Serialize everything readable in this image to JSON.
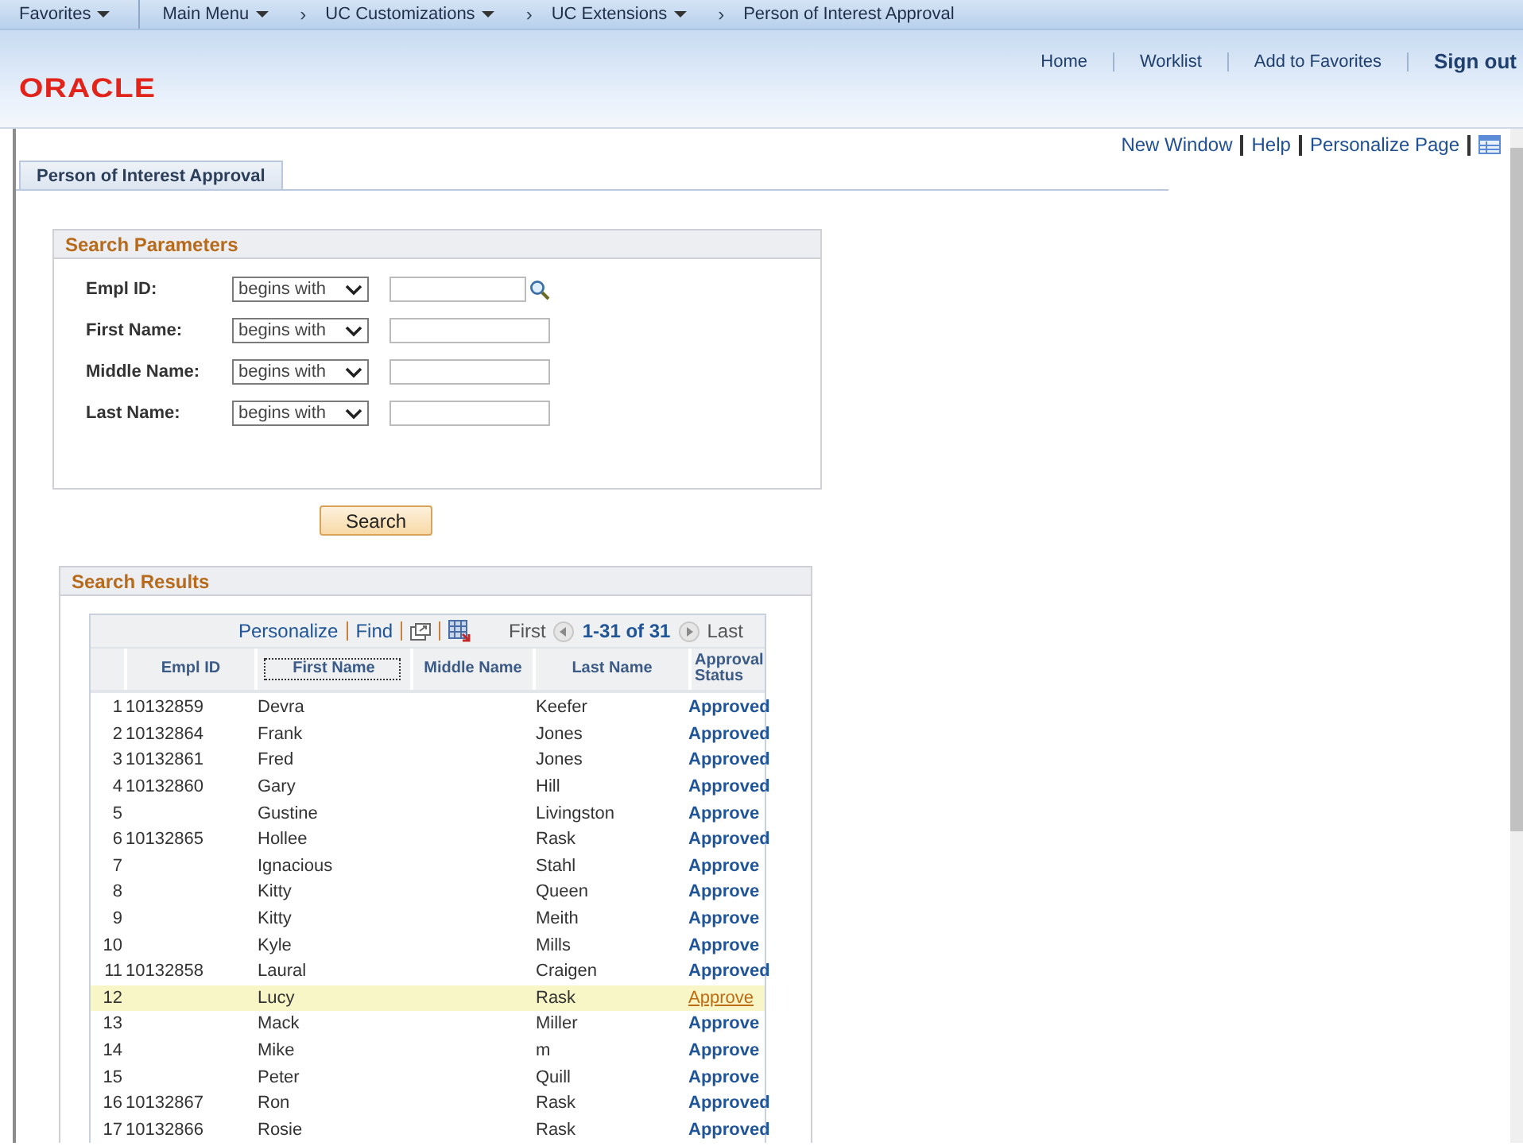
{
  "breadcrumbs": [
    {
      "label": "Favorites",
      "dropdown": true
    },
    {
      "label": "Main Menu",
      "dropdown": true
    },
    {
      "separator": "›",
      "label": "UC Customizations",
      "dropdown": true
    },
    {
      "separator": "›",
      "label": "UC Extensions",
      "dropdown": true
    },
    {
      "separator": "›",
      "label": "Person of Interest Approval",
      "dropdown": false
    }
  ],
  "logo": "ORACLE",
  "header_links": [
    "Home",
    "Worklist",
    "Add to Favorites",
    "Sign out"
  ],
  "page_links": [
    "New Window",
    "Help",
    "Personalize Page"
  ],
  "tab": {
    "label": "Person of Interest Approval",
    "selected": true
  },
  "search_parameters": {
    "title": "Search Parameters",
    "fields": [
      {
        "label": "Empl ID:",
        "operator": "begins with",
        "lookup": true
      },
      {
        "label": "First Name:",
        "operator": "begins with",
        "lookup": false
      },
      {
        "label": "Middle Name:",
        "operator": "begins with",
        "lookup": false
      },
      {
        "label": "Last Name:",
        "operator": "begins with",
        "lookup": false
      }
    ],
    "button": "Search"
  },
  "search_results": {
    "title": "Search Results",
    "toolbar": {
      "personalize": "Personalize",
      "find": "Find",
      "first": "First",
      "range": "1-31 of 31",
      "last": "Last"
    },
    "columns": [
      "Empl ID",
      "First Name",
      "Middle Name",
      "Last Name",
      "Approval Status"
    ],
    "rows": [
      {
        "num": "1",
        "empl_id": "10132859",
        "first": "Devra",
        "last": "Keefer",
        "status": "Approved",
        "selected": false
      },
      {
        "num": "2",
        "empl_id": "10132864",
        "first": "Frank",
        "last": "Jones",
        "status": "Approved",
        "selected": false
      },
      {
        "num": "3",
        "empl_id": "10132861",
        "first": "Fred",
        "last": "Jones",
        "status": "Approved",
        "selected": false
      },
      {
        "num": "4",
        "empl_id": "10132860",
        "first": "Gary",
        "last": "Hill",
        "status": "Approved",
        "selected": false
      },
      {
        "num": "5",
        "first": "Gustine",
        "last": "Livingston",
        "status": "Approve",
        "selected": false
      },
      {
        "num": "6",
        "empl_id": "10132865",
        "first": "Hollee",
        "last": "Rask",
        "status": "Approved",
        "selected": false
      },
      {
        "num": "7",
        "first": "Ignacious",
        "last": "Stahl",
        "status": "Approve",
        "selected": false
      },
      {
        "num": "8",
        "first": "Kitty",
        "last": "Queen",
        "status": "Approve",
        "selected": false
      },
      {
        "num": "9",
        "first": "Kitty",
        "last": "Meith",
        "status": "Approve",
        "selected": false
      },
      {
        "num": "10",
        "first": "Kyle",
        "last": "Mills",
        "status": "Approve",
        "selected": false
      },
      {
        "num": "11",
        "empl_id": "10132858",
        "first": "Laural",
        "last": "Craigen",
        "status": "Approved",
        "selected": false
      },
      {
        "num": "12",
        "first": "Lucy",
        "last": "Rask",
        "status": "Approve",
        "selected": true
      },
      {
        "num": "13",
        "first": "Mack",
        "last": "Miller",
        "status": "Approve",
        "selected": false
      },
      {
        "num": "14",
        "first": "Mike",
        "last": "m",
        "status": "Approve",
        "selected": false
      },
      {
        "num": "15",
        "first": "Peter",
        "last": "Quill",
        "status": "Approve",
        "selected": false
      },
      {
        "num": "16",
        "empl_id": "10132867",
        "first": "Ron",
        "last": "Rask",
        "status": "Approved",
        "selected": false
      },
      {
        "num": "17",
        "empl_id": "10132866",
        "first": "Rosie",
        "last": "Rask",
        "status": "Approved",
        "selected": false
      }
    ]
  }
}
